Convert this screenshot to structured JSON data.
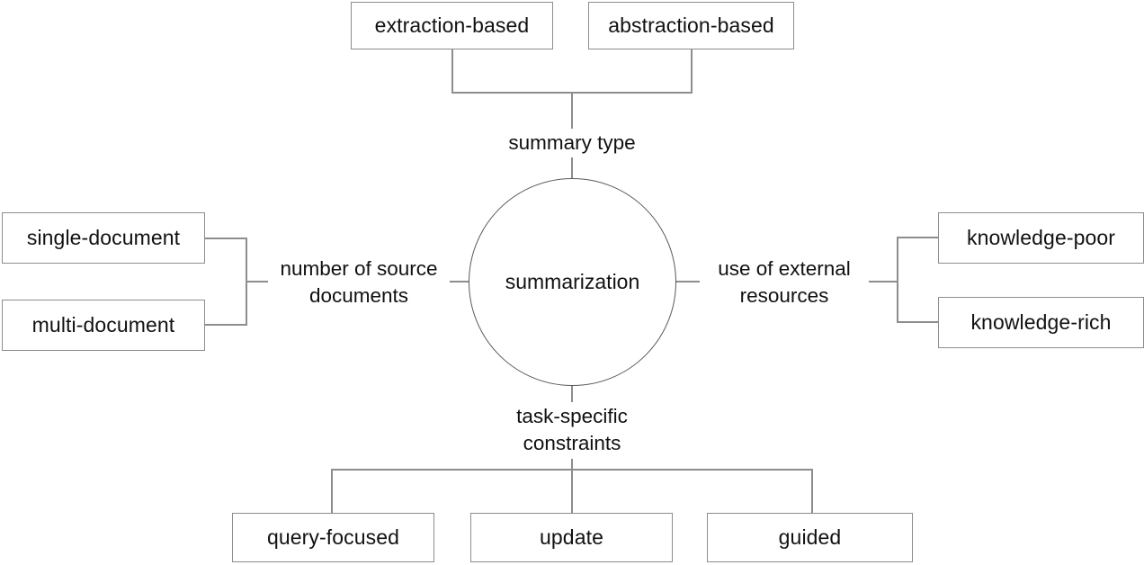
{
  "diagram": {
    "title": "summarization",
    "hub": {
      "label": "summarization"
    },
    "branches": {
      "summary_type": {
        "label": "summary type",
        "children": [
          {
            "label": "extraction-based"
          },
          {
            "label": "abstraction-based"
          }
        ]
      },
      "number_of_source_documents": {
        "label": "number of source\ndocuments",
        "children": [
          {
            "label": "single-document"
          },
          {
            "label": "multi-document"
          }
        ]
      },
      "use_of_external_resources": {
        "label": "use of external\nresources",
        "children": [
          {
            "label": "knowledge-poor"
          },
          {
            "label": "knowledge-rich"
          }
        ]
      },
      "task_specific_constraints": {
        "label": "task-specific\nconstraints",
        "children": [
          {
            "label": "query-focused"
          },
          {
            "label": "update"
          },
          {
            "label": "guided"
          }
        ]
      }
    },
    "colors": {
      "background": "#ffffff",
      "box_border": "#8d8d8d",
      "circle_border": "#5a5a5a",
      "connector": "#8d8d8d",
      "text": "#111111"
    }
  }
}
